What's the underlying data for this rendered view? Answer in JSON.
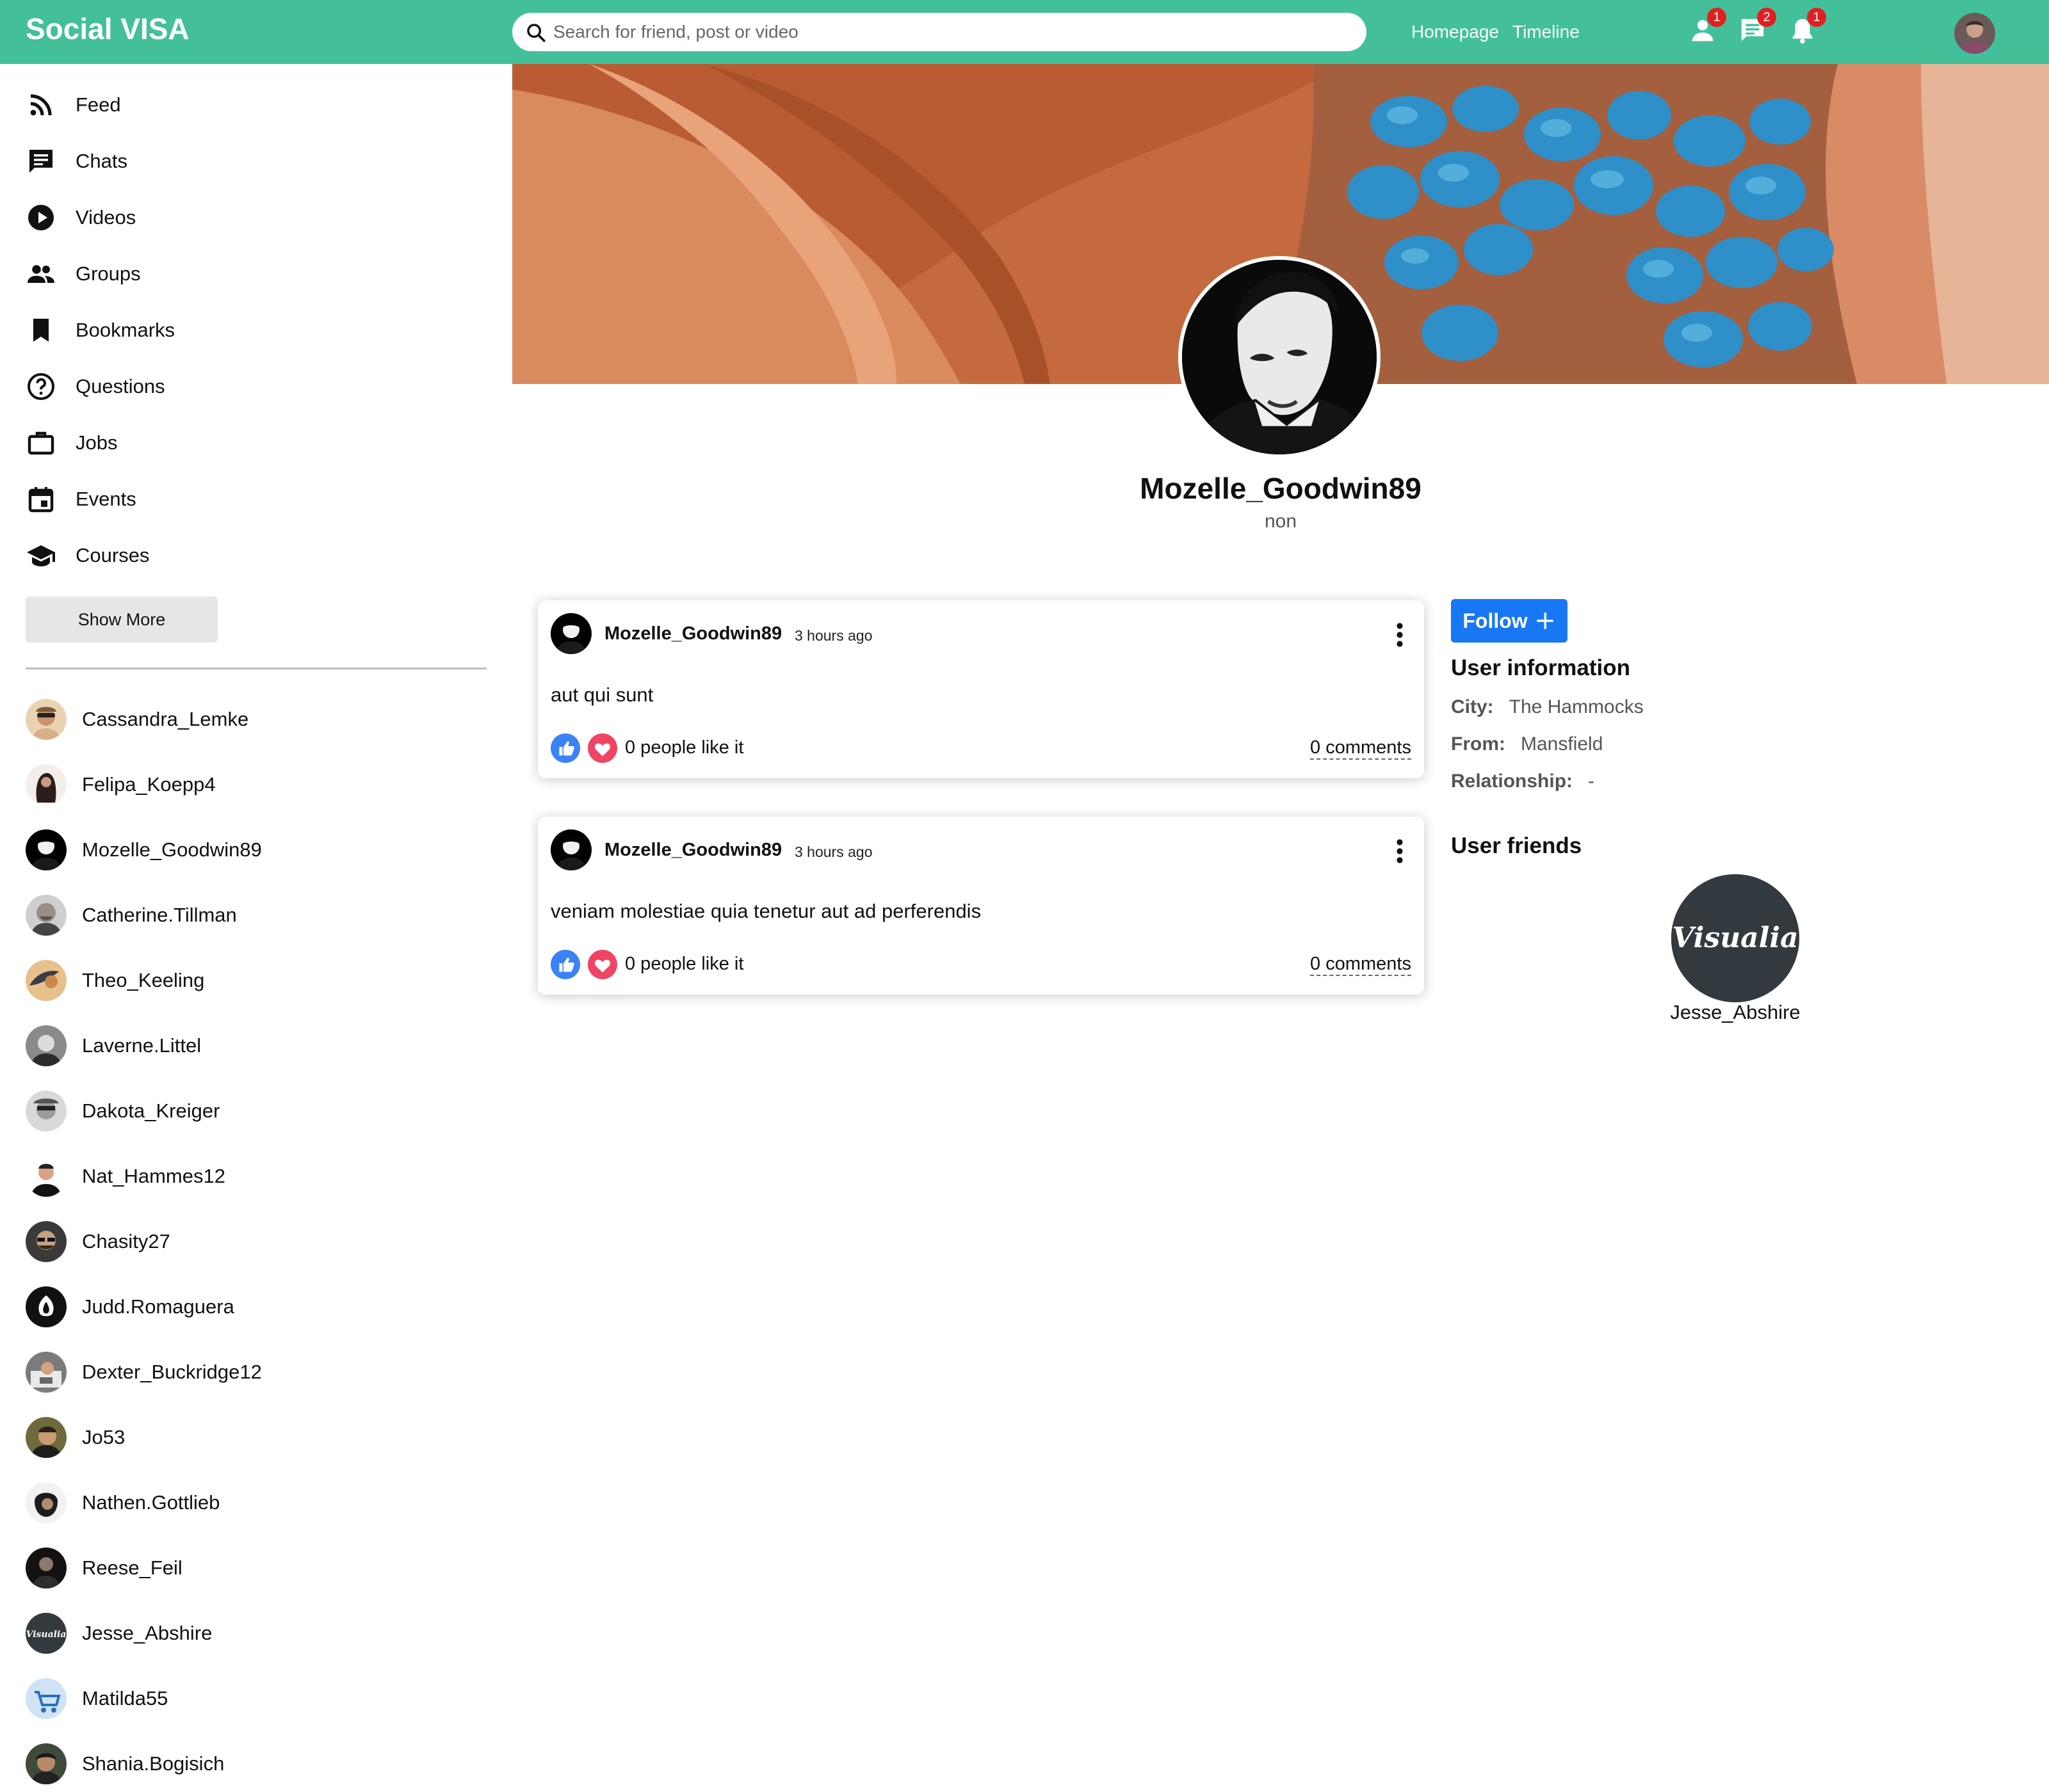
{
  "app": {
    "brand": "Social VISA"
  },
  "search": {
    "placeholder": "Search for friend, post or video"
  },
  "topnav": {
    "homepage": "Homepage",
    "timeline": "Timeline",
    "badges": {
      "friend_requests": "1",
      "messages": "2",
      "notifications": "1"
    }
  },
  "sidebar": {
    "items": [
      {
        "label": "Feed",
        "icon": "rss-feed-icon"
      },
      {
        "label": "Chats",
        "icon": "chat-icon"
      },
      {
        "label": "Videos",
        "icon": "play-circle-icon"
      },
      {
        "label": "Groups",
        "icon": "group-icon"
      },
      {
        "label": "Bookmarks",
        "icon": "bookmark-icon"
      },
      {
        "label": "Questions",
        "icon": "help-circle-icon"
      },
      {
        "label": "Jobs",
        "icon": "briefcase-icon"
      },
      {
        "label": "Events",
        "icon": "calendar-icon"
      },
      {
        "label": "Courses",
        "icon": "school-icon"
      }
    ],
    "show_more": "Show More",
    "friends": [
      "Cassandra_Lemke",
      "Felipa_Koepp4",
      "Mozelle_Goodwin89",
      "Catherine.Tillman",
      "Theo_Keeling",
      "Laverne.Littel",
      "Dakota_Kreiger",
      "Nat_Hammes12",
      "Chasity27",
      "Judd.Romaguera",
      "Dexter_Buckridge12",
      "Jo53",
      "Nathen.Gottlieb",
      "Reese_Feil",
      "Jesse_Abshire",
      "Matilda55",
      "Shania.Bogisich"
    ]
  },
  "profile": {
    "username": "Mozelle_Goodwin89",
    "description": "non"
  },
  "posts": [
    {
      "user": "Mozelle_Goodwin89",
      "time": "3 hours ago",
      "text": "aut qui sunt",
      "likes": "0 people like it",
      "comments": "0 comments"
    },
    {
      "user": "Mozelle_Goodwin89",
      "time": "3 hours ago",
      "text": "veniam molestiae quia tenetur aut ad perferendis",
      "likes": "0 people like it",
      "comments": "0 comments"
    }
  ],
  "rightbar": {
    "follow": "Follow",
    "info_title": "User information",
    "city_label": "City:",
    "city": "The Hammocks",
    "from_label": "From:",
    "from": "Mansfield",
    "relationship_label": "Relationship:",
    "relationship": "-",
    "friends_title": "User friends",
    "friend_logo_text": "Visualia",
    "friend_name": "Jesse_Abshire"
  },
  "colors": {
    "topbar": "#43c09a",
    "follow": "#1877f2",
    "like": "#3b82f6",
    "heart": "#ef4464",
    "badge": "#e02020"
  }
}
